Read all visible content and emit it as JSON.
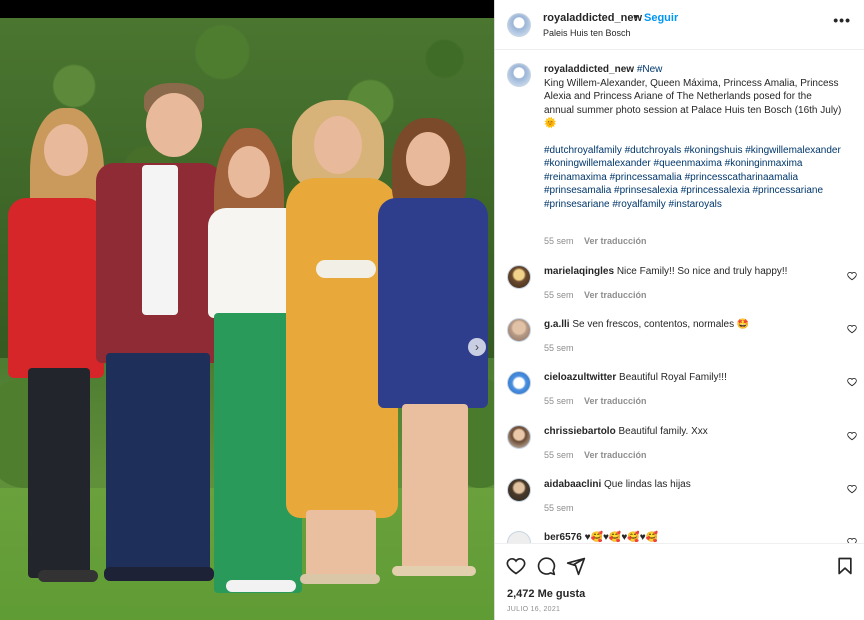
{
  "post": {
    "username": "royaladdicted_new",
    "follow_label": "Seguir",
    "separator": "•",
    "location": "Paleis Huis ten Bosch"
  },
  "caption": {
    "username": "royaladdicted_new",
    "tag_new": "#New",
    "text": "King Willem-Alexander, Queen Máxima, Princess Amalia, Princess Alexia and Princess Ariane of The Netherlands posed for the annual summer photo session at Palace Huis ten Bosch (16th July)",
    "emoji": "🌞",
    "hashtags": "#dutchroyalfamily #dutchroyals #koningshuis #kingwillemalexander #koningwillemalexander #queenmaxima #koninginmaxima #reinamaxima #princessamalia #princesscatharinaamalia #prinsesamalia #prinsesalexia #princessalexia #princessariane #prinsesariane #royalfamily #instaroyals",
    "time": "55 sem",
    "translate": "Ver traducción"
  },
  "comments": [
    {
      "username": "marielaqingles",
      "text": "Nice Family!! So nice and truly happy!!",
      "time": "55 sem",
      "translate": "Ver traducción"
    },
    {
      "username": "g.a.lli",
      "text": "Se ven frescos, contentos, normales 🤩",
      "time": "55 sem",
      "translate": ""
    },
    {
      "username": "cieloazultwitter",
      "text": "Beautiful Royal Family!!!",
      "time": "55 sem",
      "translate": "Ver traducción"
    },
    {
      "username": "chrissiebartolo",
      "text": "Beautiful family. Xxx",
      "time": "55 sem",
      "translate": "Ver traducción"
    },
    {
      "username": "aidabaaclini",
      "text": "Que lindas las hijas",
      "time": "55 sem",
      "translate": ""
    },
    {
      "username": "ber6576",
      "text": "♥🥰♥🥰♥🥰♥🥰",
      "time": "",
      "translate": ""
    }
  ],
  "stats": {
    "likes": "2,472 Me gusta",
    "date": "JULIO 16, 2021"
  },
  "icons": {
    "more": "more-options-icon",
    "like": "heart-icon",
    "comment": "comment-icon",
    "share": "share-icon",
    "save": "bookmark-icon",
    "next": "chevron-right-icon"
  },
  "colors": {
    "link_blue": "#0095f6",
    "hashtag": "#00376b",
    "meta_gray": "#8e8e8e"
  }
}
